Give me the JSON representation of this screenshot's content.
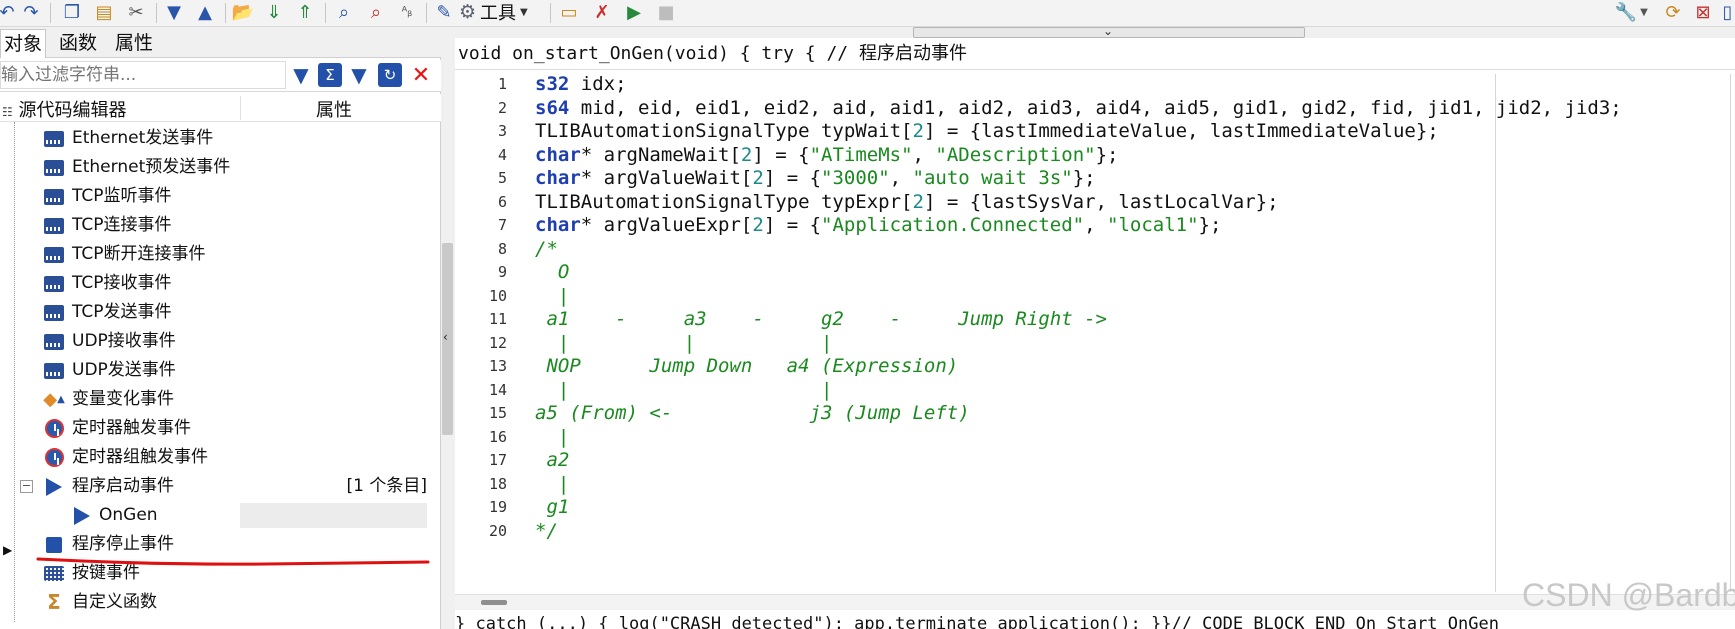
{
  "toolbar": {
    "tools_label": "工具",
    "icons": [
      "redo-back-icon",
      "redo-icon",
      "copy-icon",
      "paste-icon",
      "cut-icon",
      "move-down-icon",
      "move-up-icon",
      "open-folder-icon",
      "import-icon",
      "export-icon",
      "find-icon",
      "find-replace-icon",
      "replace-text-icon",
      "edit-icon",
      "gear-icon",
      "folder-icon",
      "clear-icon",
      "run-icon",
      "stop-icon",
      "wrench-icon",
      "sync-icon",
      "close-tab-icon",
      "window-icon"
    ]
  },
  "left_panel": {
    "tabs": [
      "对象",
      "函数",
      "属性"
    ],
    "filter_placeholder": "输入过滤字符串...",
    "tree_header": {
      "name": "源代码编辑器",
      "property": "属性"
    },
    "items": [
      {
        "label": "Ethernet发送事件",
        "icon": "network-icon"
      },
      {
        "label": "Ethernet预发送事件",
        "icon": "network-icon"
      },
      {
        "label": "TCP监听事件",
        "icon": "network-icon"
      },
      {
        "label": "TCP连接事件",
        "icon": "network-icon"
      },
      {
        "label": "TCP断开连接事件",
        "icon": "network-icon"
      },
      {
        "label": "TCP接收事件",
        "icon": "network-icon"
      },
      {
        "label": "TCP发送事件",
        "icon": "network-icon"
      },
      {
        "label": "UDP接收事件",
        "icon": "network-icon"
      },
      {
        "label": "UDP发送事件",
        "icon": "network-icon"
      },
      {
        "label": "变量变化事件",
        "icon": "variable-icon"
      },
      {
        "label": "定时器触发事件",
        "icon": "clock-icon"
      },
      {
        "label": "定时器组触发事件",
        "icon": "clock-icon"
      },
      {
        "label": "程序启动事件",
        "icon": "play-icon",
        "count": "[1 个条目]",
        "expanded": "⊟"
      },
      {
        "label": "OnGen",
        "icon": "play-icon"
      },
      {
        "label": "程序停止事件",
        "icon": "stop-icon"
      },
      {
        "label": "按键事件",
        "icon": "keyboard-icon"
      },
      {
        "label": "自定义函数",
        "icon": "sigma-icon"
      }
    ]
  },
  "editor": {
    "header": "void on_start_OnGen(void) { try { // 程序启动事件",
    "line_numbers": [
      "1",
      "2",
      "3",
      "4",
      "5",
      "6",
      "7",
      "8",
      "9",
      "10",
      "11",
      "12",
      "13",
      "14",
      "15",
      "16",
      "17",
      "18",
      "19",
      "20"
    ],
    "lines": [
      "s32 idx;",
      "s64 mid, eid, eid1, eid2, aid, aid1, aid2, aid3, aid4, aid5, gid1, gid2, fid, jid1, jid2, jid3;",
      "TLIBAutomationSignalType typWait[2] = {lastImmediateValue, lastImmediateValue};",
      "char* argNameWait[2] = {\"ATimeMs\", \"ADescription\"};",
      "char* argValueWait[2] = {\"3000\", \"auto wait 3s\"};",
      "TLIBAutomationSignalType typExpr[2] = {lastSysVar, lastLocalVar};",
      "char* argValueExpr[2] = {\"Application.Connected\", \"local1\"};",
      "/*",
      "  O",
      "  |",
      " a1    -     a3    -     g2    -     Jump Right ->",
      "  |          |           |",
      " NOP      Jump Down   a4 (Expression)",
      "  |                      |",
      "a5 (From) <-            j3 (Jump Left)",
      "  |",
      " a2",
      "  |",
      " g1",
      "*/"
    ],
    "bottom_text": "} catch (...) { log(\"CRASH detected\"); app.terminate_application(); }}// CODE BLOCK END On Start OnGen"
  },
  "watermark": "CSDN @Bardb",
  "colors": {
    "keyword": "#1f3fb0",
    "string": "#1a8a1f",
    "number": "#1a8a8a",
    "comment": "#1a8a1f",
    "annotation": "#dd1111"
  }
}
